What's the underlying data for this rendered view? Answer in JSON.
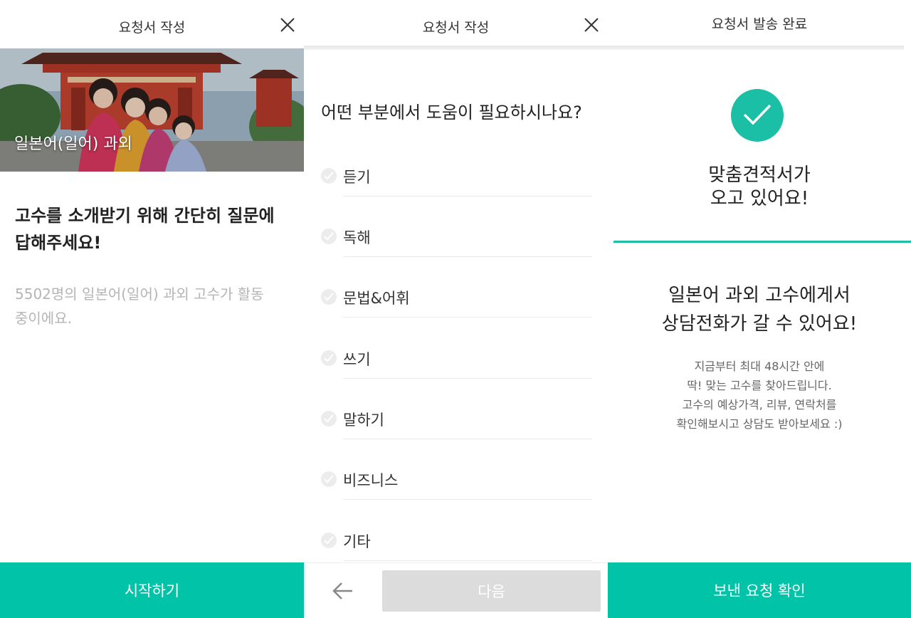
{
  "colors": {
    "accent": "#01c3a8",
    "check_green": "#1bbfa5",
    "disabled": "#dcdcdc"
  },
  "panel1": {
    "title": "요청서 작성",
    "close_icon": "close-icon",
    "hero_title": "일본어(일어) 과외",
    "heading_line1": "고수를 소개받기 위해 간단히 질문에",
    "heading_line2": "답해주세요!",
    "sub_line1": "5502명의 일본어(일어) 과외 고수가 활동",
    "sub_line2": "중이에요.",
    "start_button": "시작하기"
  },
  "panel2": {
    "title": "요청서 작성",
    "close_icon": "close-icon",
    "question": "어떤 부분에서 도움이 필요하시나요?",
    "options": [
      {
        "label": "듣기",
        "checked": false
      },
      {
        "label": "독해",
        "checked": false
      },
      {
        "label": "문법&어휘",
        "checked": false
      },
      {
        "label": "쓰기",
        "checked": false
      },
      {
        "label": "말하기",
        "checked": false
      },
      {
        "label": "비즈니스",
        "checked": false
      },
      {
        "label": "기타",
        "checked": false
      }
    ],
    "back_icon": "arrow-left-icon",
    "next_button": "다음"
  },
  "panel3": {
    "title": "요청서 발송 완료",
    "check_icon": "check-circle-icon",
    "heading_line1": "맞춤견적서가",
    "heading_line2": "오고 있어요!",
    "message_line1": "일본어 과외 고수에게서",
    "message_line2": "상담전화가 갈 수 있어요!",
    "desc_line1": "지금부터 최대 48시간 안에",
    "desc_line2": "딱! 맞는 고수를 찾아드립니다.",
    "desc_line3": "고수의 예상가격, 리뷰, 연락처를",
    "desc_line4": "확인해보시고 상담도 받아보세요 :)",
    "confirm_button": "보낸 요청 확인"
  }
}
